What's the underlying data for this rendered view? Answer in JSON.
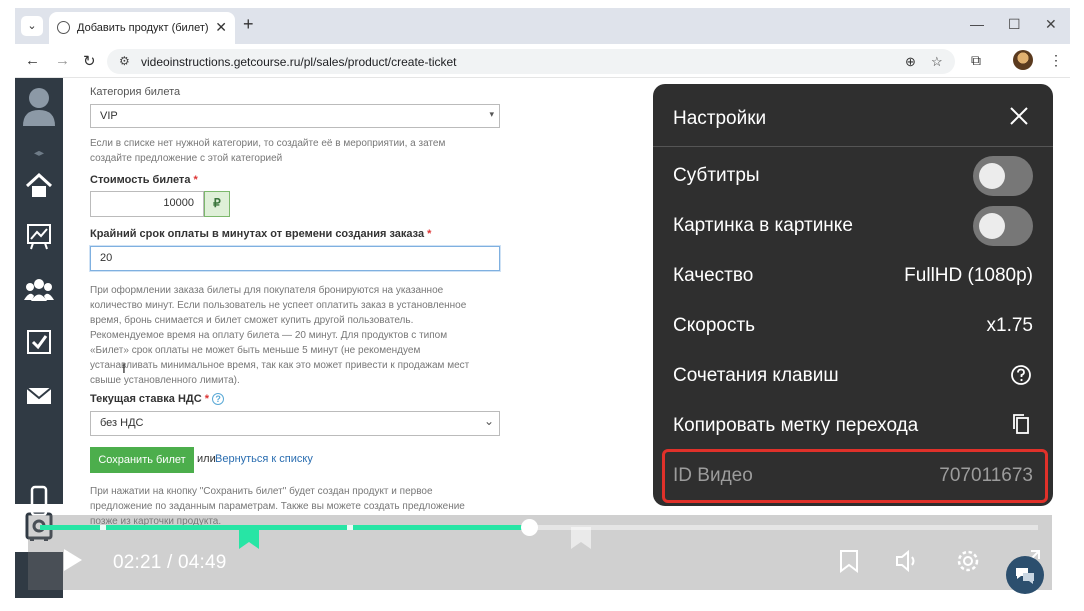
{
  "browser": {
    "tab_title": "Добавить продукт (билет)",
    "url": "videoinstructions.getcourse.ru/pl/sales/product/create-ticket"
  },
  "form": {
    "category_label": "Категория билета",
    "category_value": "VIP",
    "category_help_1": "Если в списке нет нужной категории, то создайте её в мероприятии, а затем",
    "category_help_2": "создайте предложение с этой категорией",
    "price_label": "Стоимость билета",
    "price_value": "10000",
    "currency": "₽",
    "deadline_label": "Крайний срок оплаты в минутах от времени создания заказа",
    "deadline_value": "20",
    "deadline_help": [
      "При оформлении заказа билеты для покупателя бронируются на указанное",
      "количество минут. Если пользователь не успеет оплатить заказ в установленное",
      "время, бронь снимается и билет сможет купить другой пользователь.",
      "Рекомендуемое время на оплату билета — 20 минут. Для продуктов с типом",
      "«Билет» срок оплаты не может быть меньше 5 минут (не рекомендуем",
      "устанавливать минимальное время, так как это может привести к продажам мест",
      "свыше установленного лимита)."
    ],
    "vat_label": "Текущая ставка НДС",
    "vat_value": "без НДС",
    "save_label": "Сохранить билет",
    "or_text": "или",
    "back_link": "Вернуться к списку",
    "footer_help": [
      "При нажатии на кнопку \"Сохранить билет\" будет создан продукт и первое",
      "предложение по заданным параметрам. Также вы можете создать предложение",
      "позже из карточки продукта."
    ],
    "required_mark": "*"
  },
  "player": {
    "time": "02:21 / 04:49",
    "progress": 0.49,
    "accent": "#27e5a5"
  },
  "settings": {
    "title": "Настройки",
    "subtitles_label": "Субтитры",
    "pip_label": "Картинка в картинке",
    "quality_label": "Качество",
    "quality_value": "FullHD (1080p)",
    "speed_label": "Скорость",
    "speed_value": "x1.75",
    "hotkeys_label": "Сочетания клавиш",
    "copy_mark_label": "Копировать метку перехода",
    "video_id_label": "ID Видео",
    "video_id_value": "707011673",
    "subtitles_on": false,
    "pip_on": false,
    "highlight_color": "#e0312a"
  }
}
